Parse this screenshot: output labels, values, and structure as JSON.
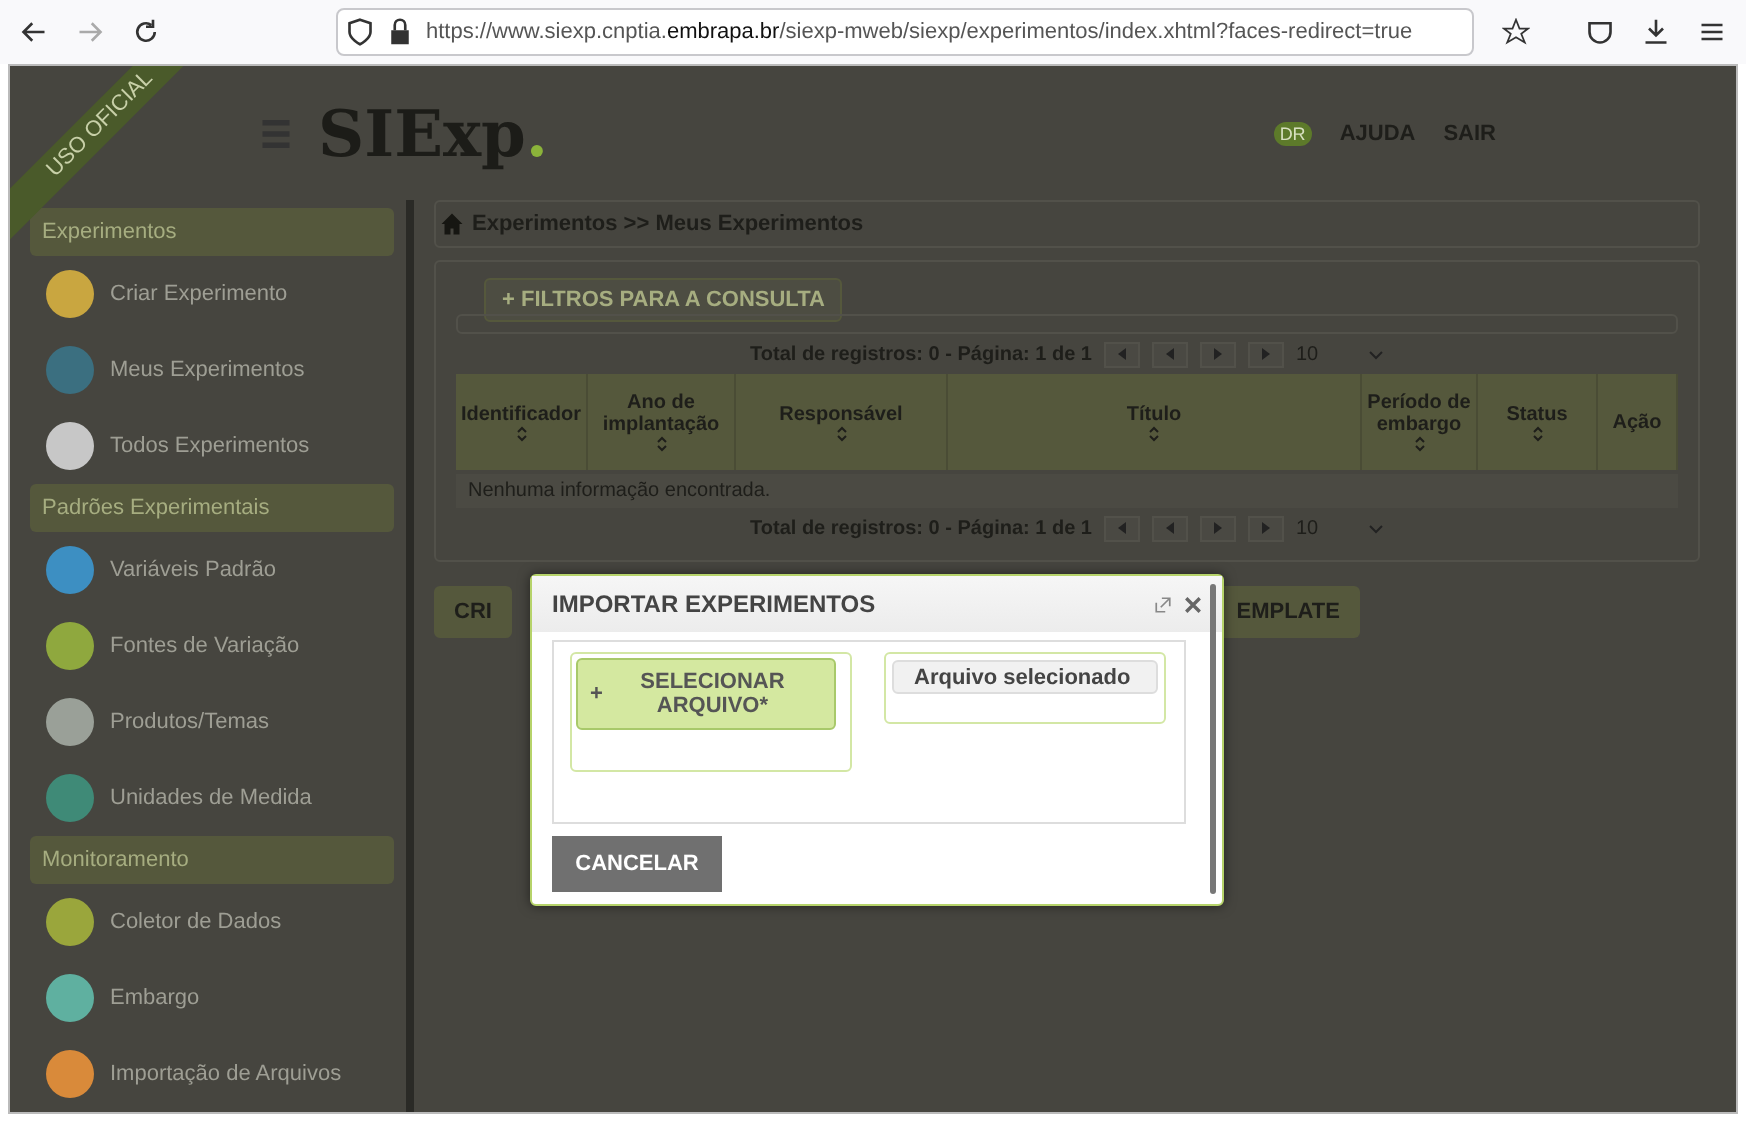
{
  "browser": {
    "url_prefix": "https://www.siexp.cnptia.",
    "url_domain": "embrapa.br",
    "url_rest": "/siexp-mweb/siexp/experimentos/index.xhtml?faces-redirect=true"
  },
  "ribbon": "USO OFICIAL",
  "header": {
    "logo": "SIExp",
    "logo_dot": ".",
    "badge": "DR",
    "links": [
      "AJUDA",
      "SAIR"
    ]
  },
  "sidebar": [
    {
      "title": "Experimentos",
      "items": [
        {
          "label": "Criar Experimento",
          "color": "#c9a640"
        },
        {
          "label": "Meus Experimentos",
          "color": "#3b6f80"
        },
        {
          "label": "Todos Experimentos",
          "color": "#c7c7c7"
        }
      ]
    },
    {
      "title": "Padrões Experimentais",
      "items": [
        {
          "label": "Variáveis Padrão",
          "color": "#3d8fc2"
        },
        {
          "label": "Fontes de Variação",
          "color": "#8fa83e"
        },
        {
          "label": "Produtos/Temas",
          "color": "#9aa098"
        },
        {
          "label": "Unidades de Medida",
          "color": "#3f8a77"
        }
      ]
    },
    {
      "title": "Monitoramento",
      "items": [
        {
          "label": "Coletor de Dados",
          "color": "#9aa63c"
        },
        {
          "label": "Embargo",
          "color": "#5fb0a0"
        },
        {
          "label": "Importação de Arquivos",
          "color": "#d98a3a"
        }
      ]
    }
  ],
  "breadcrumb": "Experimentos >> Meus Experimentos",
  "filters_button": "+ FILTROS PARA A CONSULTA",
  "pagination_top": {
    "text": "Total de registros: 0 - Página: 1 de 1",
    "page_size": "10"
  },
  "table": {
    "columns": [
      {
        "label": "Identificador",
        "sortable": true
      },
      {
        "label": "Ano de implantação",
        "sortable": true
      },
      {
        "label": "Responsável",
        "sortable": true
      },
      {
        "label": "Título",
        "sortable": true
      },
      {
        "label": "Período de embargo",
        "sortable": true
      },
      {
        "label": "Status",
        "sortable": true
      },
      {
        "label": "Ação",
        "sortable": false
      }
    ],
    "empty_message": "Nenhuma informação encontrada."
  },
  "pagination_bottom": {
    "text": "Total de registros: 0 - Página: 1 de 1",
    "page_size": "10"
  },
  "actions": [
    "CRI",
    "EMPLATE"
  ],
  "dialog": {
    "title": "IMPORTAR EXPERIMENTOS",
    "select_button": "SELECIONAR ARQUIVO*",
    "plus": "+",
    "file_label": "Arquivo selecionado",
    "cancel": "CANCELAR"
  }
}
